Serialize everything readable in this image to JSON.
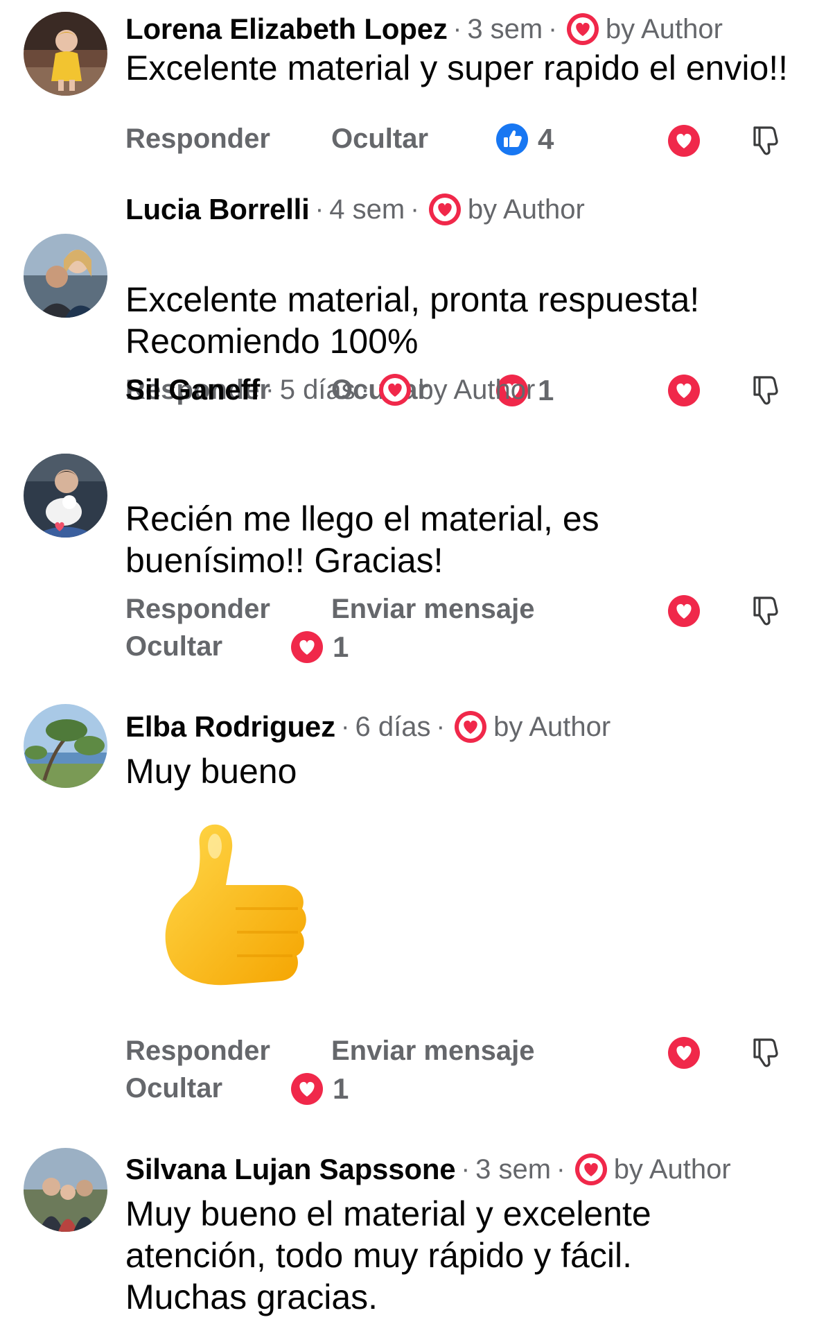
{
  "by_author_label": "by Author",
  "actions": {
    "reply": "Responder",
    "hide": "Ocultar",
    "message": "Enviar mensaje"
  },
  "colors": {
    "heart": "#f0284a",
    "like_blue": "#1877f2",
    "meta_gray": "#65676b"
  },
  "comments": [
    {
      "name": "Lorena Elizabeth Lopez",
      "time": "3 sem",
      "text": "Excelente material y super rapido el envio!!",
      "reaction_icon": "like-icon",
      "reaction_count": "4"
    },
    {
      "name": "Lucia Borrelli",
      "time": "4 sem",
      "text": "Excelente material, pronta respuesta! Recomiendo 100%",
      "reaction_icon": "love-icon",
      "reaction_count": "1"
    },
    {
      "name": "Sil Ganeff",
      "time": "5 días",
      "text": "Recién me llego el material, es buenísimo!! Gracias!",
      "reaction_icon": "love-icon",
      "reaction_count": "1"
    },
    {
      "name": "Elba Rodriguez",
      "time": "6 días",
      "text": "Muy bueno",
      "sticker": "thumbs-up-sticker",
      "reaction_icon": "love-icon",
      "reaction_count": "1"
    },
    {
      "name": "Silvana Lujan Sapssone",
      "time": "3 sem",
      "text": "Muy bueno el material y excelente atención, todo muy rápido y fácil. Muchas gracias."
    }
  ]
}
